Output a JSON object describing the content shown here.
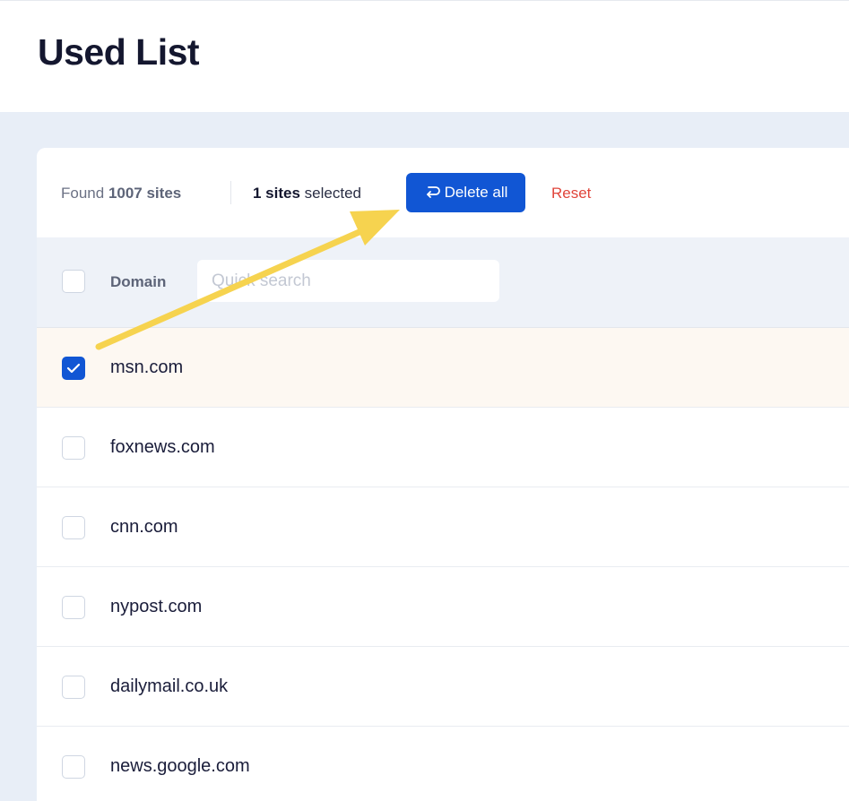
{
  "page": {
    "title": "Used List"
  },
  "toolbar": {
    "found_prefix": "Found",
    "found_count": "1007 sites",
    "selected_count": "1 sites",
    "selected_suffix": "selected",
    "delete_all_label": "Delete all",
    "reset_label": "Reset"
  },
  "table": {
    "domain_header": "Domain",
    "search_placeholder": "Quick search",
    "rows": [
      {
        "domain": "msn.com",
        "checked": true
      },
      {
        "domain": "foxnews.com",
        "checked": false
      },
      {
        "domain": "cnn.com",
        "checked": false
      },
      {
        "domain": "nypost.com",
        "checked": false
      },
      {
        "domain": "dailymail.co.uk",
        "checked": false
      },
      {
        "domain": "news.google.com",
        "checked": false
      }
    ]
  },
  "icons": {
    "delete_all_button": "return-arrow-icon",
    "checked_row": "checkmark-icon",
    "annotation": "annotation-arrow"
  },
  "colors": {
    "accent": "#1156d4",
    "reset": "#e0453b",
    "annotation_arrow": "#f6d34f",
    "selected_row_bg": "#fdf8f2",
    "page_bg": "#e8eef7"
  }
}
